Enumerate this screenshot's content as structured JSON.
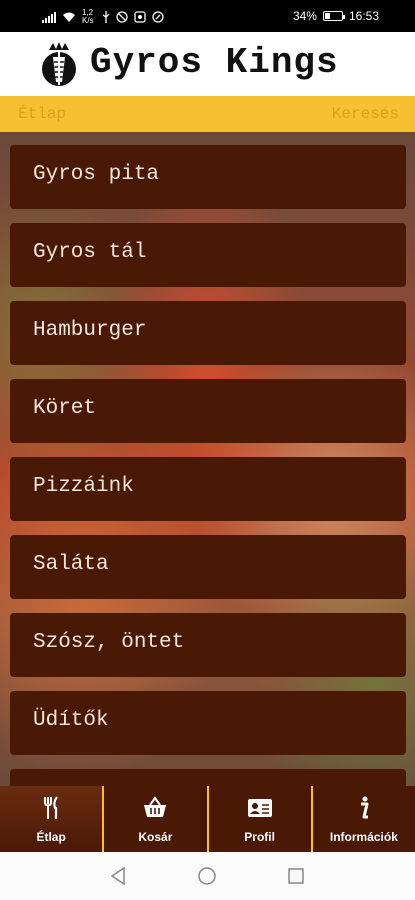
{
  "status_bar": {
    "net_speed": "1,2 K/s",
    "battery": "34%",
    "battery_level": 34,
    "time": "16:53"
  },
  "header": {
    "title": "Gyros Kings",
    "logo": "gyros-kings-logo"
  },
  "sub_bar": {
    "left_label": "Étlap",
    "right_label": "Keresés"
  },
  "menu": {
    "items": [
      {
        "label": "Gyros pita"
      },
      {
        "label": "Gyros tál"
      },
      {
        "label": "Hamburger"
      },
      {
        "label": "Köret"
      },
      {
        "label": "Pizzáink"
      },
      {
        "label": "Saláta"
      },
      {
        "label": "Szósz, öntet"
      },
      {
        "label": "Üdítők"
      }
    ]
  },
  "tabs": [
    {
      "label": "Étlap",
      "icon": "fork-knife-icon",
      "active": true
    },
    {
      "label": "Kosár",
      "icon": "basket-icon",
      "active": false
    },
    {
      "label": "Profil",
      "icon": "id-card-icon",
      "active": false
    },
    {
      "label": "Információk",
      "icon": "info-icon",
      "active": false
    }
  ],
  "colors": {
    "accent": "#f5c131",
    "menu_item_bg": "#4a1906",
    "menu_text": "#f2e6dc"
  }
}
